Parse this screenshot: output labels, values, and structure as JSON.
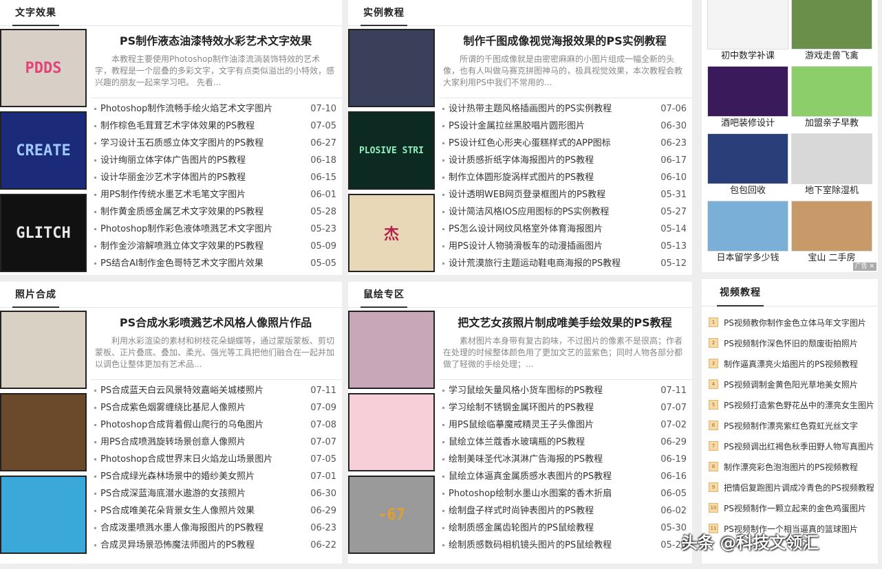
{
  "sections": [
    {
      "title": "文字效果",
      "lead": {
        "title": "PS制作液态油漆特效水彩艺术文字效果",
        "desc": "本教程主要使用Photoshop制作油漆流淌装饰特效的艺术字，教程是一个层叠的多彩文字，文字有点类似溢出的小特效，感兴趣的朋友一起来学习吧。 先看..."
      },
      "thumbs": [
        {
          "text": "PDDS",
          "bg": "#d8cfc6",
          "fg": "#e0457a"
        },
        {
          "text": "CREATE",
          "bg": "#1c2a7a",
          "fg": "#9ec9ff"
        },
        {
          "text": "GLITCH",
          "bg": "#111111",
          "fg": "#e8e8e8"
        }
      ],
      "items": [
        {
          "t": "Photoshop制作流畅手绘火焰艺术文字图片",
          "d": "07-10"
        },
        {
          "t": "制作棕色毛茸茸艺术字体效果的PS教程",
          "d": "07-05"
        },
        {
          "t": "学习设计玉石质感立体文字图片的PS教程",
          "d": "06-27"
        },
        {
          "t": "设计绚丽立体字体广告图片的PS教程",
          "d": "06-18"
        },
        {
          "t": "设计华丽金沙艺术字体图片的PS教程",
          "d": "06-15"
        },
        {
          "t": "用PS制作传统水墨艺术毛笔文字图片",
          "d": "06-01"
        },
        {
          "t": "制作黄金质感金属艺术文字效果的PS教程",
          "d": "05-28"
        },
        {
          "t": "Photoshop制作彩色液体喷溅艺术文字图片",
          "d": "05-23"
        },
        {
          "t": "制作金沙溶解喷溅立体文字效果的PS教程",
          "d": "05-09"
        },
        {
          "t": "PS结合AI制作金色哥特艺术文字图片效果",
          "d": "05-05"
        }
      ]
    },
    {
      "title": "实例教程",
      "lead": {
        "title": "制作千图成像视觉海报效果的PS实例教程",
        "desc": "所谓的千图成像就是由密密麻麻的小图片组成一幅全新的头像，也有人叫做马赛克拼图神马的，极具视觉效果，本次教程会教大家利用PS中我们不常用的..."
      },
      "thumbs": [
        {
          "text": "",
          "bg": "#3a3f5a",
          "fg": "#ffffff"
        },
        {
          "text": "PLOSIVE STRI",
          "bg": "#0d2a22",
          "fg": "#8ff0c0"
        },
        {
          "text": "杰",
          "bg": "#e9d8b8",
          "fg": "#b0204a"
        }
      ],
      "items": [
        {
          "t": "设计热带主题风格插画图片的PS实例教程",
          "d": "07-06"
        },
        {
          "t": "PS设计金属拉丝黑胶唱片圆形图片",
          "d": "06-30"
        },
        {
          "t": "PS设计红色心形夹心蛋糕样式的APP图标",
          "d": "06-23"
        },
        {
          "t": "设计质感折纸字体海报图片的PS教程",
          "d": "06-17"
        },
        {
          "t": "制作立体圆形旋涡样式图片的PS教程",
          "d": "06-10"
        },
        {
          "t": "设计透明WEB网页登录框图片的PS教程",
          "d": "05-31"
        },
        {
          "t": "设计简洁风格IOS应用图标的PS实例教程",
          "d": "05-27"
        },
        {
          "t": "PS怎么设计网纹风格室外体育海报图片",
          "d": "05-14"
        },
        {
          "t": "用PS设计人物骑滑板车的动漫插画图片",
          "d": "05-13"
        },
        {
          "t": "设计荒漠旅行主题运动鞋电商海报的PS教程",
          "d": "05-12"
        }
      ]
    },
    {
      "title": "照片合成",
      "lead": {
        "title": "PS合成水彩喷溅艺术风格人像照片作品",
        "desc": "利用水彩渲染的素材和树枝花朵蝴蝶等，通过蒙版蒙板、剪切蒙板、正片叠底、叠加、柔光、强光等工具把他们融合在一起并加以调色让整体更加有艺术品..."
      },
      "thumbs": [
        {
          "text": "",
          "bg": "#d9d2c4",
          "fg": "#333"
        },
        {
          "text": "",
          "bg": "#6a4a2a",
          "fg": "#ffb060"
        },
        {
          "text": "",
          "bg": "#3aa8d8",
          "fg": "#f0c040"
        }
      ],
      "items": [
        {
          "t": "PS合成蓝天白云风景特效嘉峪关城楼照片",
          "d": "07-11"
        },
        {
          "t": "PS合成紫色烟雾缠绕比基尼人像照片",
          "d": "07-09"
        },
        {
          "t": "Photoshop合成背着假山爬行的乌龟图片",
          "d": "07-08"
        },
        {
          "t": "用PS合成喷溅旋转场景创意人像照片",
          "d": "07-07"
        },
        {
          "t": "Photoshop合成世界末日火焰龙山场景图片",
          "d": "07-05"
        },
        {
          "t": "PS合成绿光森林场景中的婚纱美女照片",
          "d": "07-01"
        },
        {
          "t": "PS合成深蓝海底潜水遨游的女孩照片",
          "d": "06-30"
        },
        {
          "t": "PS合成唯美花朵背景女生人像照片效果",
          "d": "06-29"
        },
        {
          "t": "合成泼墨喷溅水墨人像海报图片的PS教程",
          "d": "06-23"
        },
        {
          "t": "合成灵异场景恐怖魔法师图片的PS教程",
          "d": "06-22"
        }
      ]
    },
    {
      "title": "鼠绘专区",
      "lead": {
        "title": "把文艺女孩照片制成唯美手绘效果的PS教程",
        "desc": "素材图片本身带有复古韵味，不过图片的像素不是很高；作者在处理的时候整体颜色用了更加文艺的蓝紫色；同时人物各部分都做了轻微的手绘处理；..."
      },
      "thumbs": [
        {
          "text": "",
          "bg": "#c8a8b8",
          "fg": "#222"
        },
        {
          "text": "",
          "bg": "#f6cfd8",
          "fg": "#fff"
        },
        {
          "text": "-67",
          "bg": "#9a9a9a",
          "fg": "#e0a030"
        }
      ],
      "items": [
        {
          "t": "学习鼠绘矢量风格小货车图标的PS教程",
          "d": "07-11"
        },
        {
          "t": "学习绘制不锈钢金属环图片的PS教程",
          "d": "07-07"
        },
        {
          "t": "用PS鼠绘临摹魔戒精灵王子头像图片",
          "d": "07-02"
        },
        {
          "t": "鼠绘立体兰蔻香水玻璃瓶的PS教程",
          "d": "06-29"
        },
        {
          "t": "绘制美味圣代冰淇淋广告海报的PS教程",
          "d": "06-19"
        },
        {
          "t": "鼠绘立体逼真金属质感水表图片的PS教程",
          "d": "06-16"
        },
        {
          "t": "Photoshop绘制水墨山水图案的香木折扇",
          "d": "06-05"
        },
        {
          "t": "绘制盘子样式时尚钟表图片的PS教程",
          "d": "06-02"
        },
        {
          "t": "绘制质感金属齿轮图片的PS鼠绘教程",
          "d": "05-30"
        },
        {
          "t": "绘制质感数码相机镜头图片的PS鼠绘教程",
          "d": "05-20"
        }
      ]
    }
  ],
  "ads": [
    {
      "cap": "初中数学补课",
      "bg": "#f4f4f4"
    },
    {
      "cap": "游戏走兽飞禽",
      "bg": "#6a8f4a"
    },
    {
      "cap": "酒吧装修设计",
      "bg": "#3a1a5a"
    },
    {
      "cap": "加盟亲子早教",
      "bg": "#8ccf6a"
    },
    {
      "cap": "包包回收",
      "bg": "#2a3f7a"
    },
    {
      "cap": "地下室除湿机",
      "bg": "#d8d8d8"
    },
    {
      "cap": "日本留学多少钱",
      "bg": "#7ab0d8"
    },
    {
      "cap": "宝山 二手房",
      "bg": "#c89a6a"
    }
  ],
  "ad_label": "广告",
  "video": {
    "title": "视频教程",
    "items": [
      {
        "n": "1",
        "t": "PS视频教你制作金色立体马年文字图片"
      },
      {
        "n": "2",
        "t": "PS视频制作深色怀旧的颓废街拍照片"
      },
      {
        "n": "3",
        "t": "制作逼真漂亮火焰图片的PS视频教程"
      },
      {
        "n": "4",
        "t": "PS视频调制金黄色阳光草地美女照片"
      },
      {
        "n": "5",
        "t": "PS视频打造紫色野花丛中的漂亮女生图片"
      },
      {
        "n": "6",
        "t": "PS视频制作漂亮紫红色霓虹光丝文字"
      },
      {
        "n": "7",
        "t": "PS视频调出红褐色秋季田野人物写真图片"
      },
      {
        "n": "8",
        "t": "制作漂亮彩色泡泡图片的PS视频教程"
      },
      {
        "n": "9",
        "t": "把情侣复跑图片调成冷青色的PS视频教程"
      },
      {
        "n": "10",
        "t": "PS视频制作一颗立起来的金色鸡蛋图片"
      },
      {
        "n": "11",
        "t": "PS视频制作一个相当逼真的篮球图片"
      }
    ]
  },
  "watermark": "头条 @科技文领汇"
}
